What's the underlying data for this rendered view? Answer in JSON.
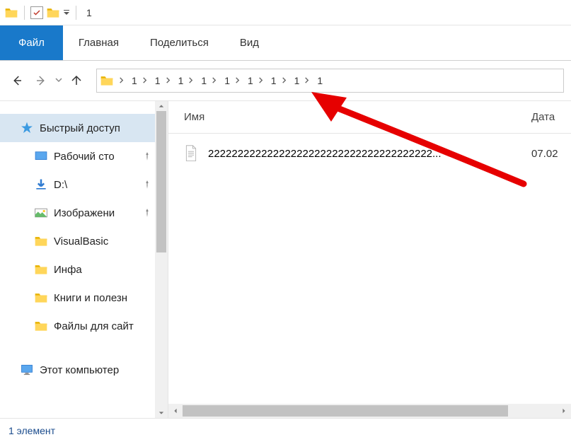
{
  "titlebar": {
    "title": "1"
  },
  "ribbon": {
    "file": "Файл",
    "tabs": [
      "Главная",
      "Поделиться",
      "Вид"
    ]
  },
  "breadcrumb": {
    "segments": [
      "1",
      "1",
      "1",
      "1",
      "1",
      "1",
      "1",
      "1",
      "1"
    ]
  },
  "sidebar": {
    "quick_access": "Быстрый доступ",
    "items": [
      {
        "label": "Рабочий сто",
        "icon": "desktop",
        "pinned": true
      },
      {
        "label": "D:\\",
        "icon": "download",
        "pinned": true
      },
      {
        "label": "Изображени",
        "icon": "pictures",
        "pinned": true
      },
      {
        "label": "VisualBasic",
        "icon": "folder",
        "pinned": false
      },
      {
        "label": "Инфа",
        "icon": "folder",
        "pinned": false
      },
      {
        "label": "Книги и полезн",
        "icon": "folder",
        "pinned": false
      },
      {
        "label": "Файлы для сайт",
        "icon": "folder",
        "pinned": false
      }
    ],
    "this_pc": "Этот компьютер"
  },
  "columns": {
    "name": "Имя",
    "date": "Дата"
  },
  "files": [
    {
      "name": "22222222222222222222222222222222222222...",
      "date": "07.02"
    }
  ],
  "status": {
    "count_text": "1 элемент"
  }
}
